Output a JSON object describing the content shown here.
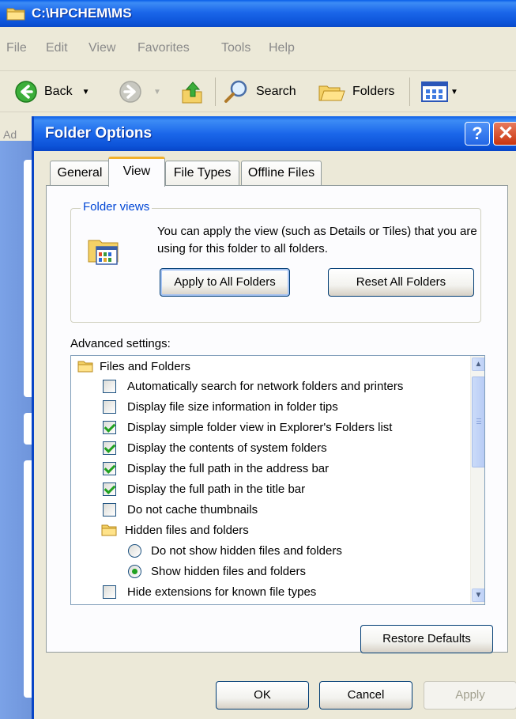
{
  "explorer": {
    "title": "C:\\HPCHEM\\MS",
    "menu": [
      "File",
      "Edit",
      "View",
      "Favorites",
      "Tools",
      "Help"
    ],
    "toolbar": {
      "back_label": "Back",
      "search_label": "Search",
      "folders_label": "Folders"
    },
    "address_label": "Ad"
  },
  "dialog": {
    "title": "Folder Options",
    "help_glyph": "?",
    "close_glyph": "✕",
    "tabs": [
      "General",
      "View",
      "File Types",
      "Offline Files"
    ],
    "active_tab": "View",
    "folder_views": {
      "legend": "Folder views",
      "description": "You can apply the view (such as Details or Tiles) that you are using for this folder to all folders.",
      "apply_label": "Apply to All Folders",
      "reset_label": "Reset All Folders"
    },
    "advanced_label": "Advanced settings:",
    "settings": [
      {
        "type": "folder",
        "label": "Files and Folders"
      },
      {
        "type": "checkbox",
        "label": "Automatically search for network folders and printers",
        "checked": false
      },
      {
        "type": "checkbox",
        "label": "Display file size information in folder tips",
        "checked": false
      },
      {
        "type": "checkbox",
        "label": "Display simple folder view in Explorer's Folders list",
        "checked": true
      },
      {
        "type": "checkbox",
        "label": "Display the contents of system folders",
        "checked": true
      },
      {
        "type": "checkbox",
        "label": "Display the full path in the address bar",
        "checked": true
      },
      {
        "type": "checkbox",
        "label": "Display the full path in the title bar",
        "checked": true
      },
      {
        "type": "checkbox",
        "label": "Do not cache thumbnails",
        "checked": false
      },
      {
        "type": "subfolder",
        "label": "Hidden files and folders"
      },
      {
        "type": "radio",
        "label": "Do not show hidden files and folders",
        "checked": false
      },
      {
        "type": "radio",
        "label": "Show hidden files and folders",
        "checked": true
      },
      {
        "type": "checkbox",
        "label": "Hide extensions for known file types",
        "checked": false
      }
    ],
    "restore_label": "Restore Defaults",
    "ok_label": "OK",
    "cancel_label": "Cancel",
    "apply_label": "Apply"
  }
}
